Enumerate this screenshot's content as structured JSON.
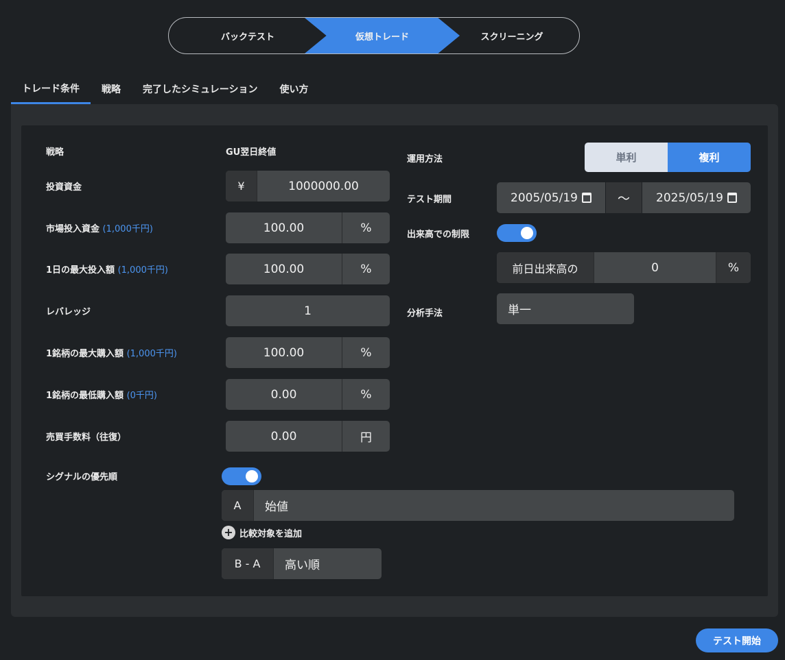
{
  "mode_switch": {
    "items": [
      "バックテスト",
      "仮想トレード",
      "スクリーニング"
    ],
    "active": "仮想トレード"
  },
  "tabs": [
    "トレード条件",
    "戦略",
    "完了したシミュレーション",
    "使い方"
  ],
  "left": {
    "strategy_label": "戦略",
    "strategy_value": "GU翌日終値",
    "capital_label": "投資資金",
    "capital_prefix": "¥",
    "capital_value": "1000000.00",
    "market_label": "市場投入資金",
    "market_hint": "(1,000千円)",
    "market_value": "100.00",
    "market_unit": "%",
    "daily_label": "1日の最大投入額",
    "daily_hint": "(1,000千円)",
    "daily_value": "100.00",
    "daily_unit": "%",
    "leverage_label": "レバレッジ",
    "leverage_value": "1",
    "max_buy_label": "1銘柄の最大購入額",
    "max_buy_hint": "(1,000千円)",
    "max_buy_value": "100.00",
    "max_buy_unit": "%",
    "min_buy_label": "1銘柄の最低購入額",
    "min_buy_hint": "(0千円)",
    "min_buy_value": "0.00",
    "min_buy_unit": "%",
    "fee_label": "売買手数料（往復）",
    "fee_value": "0.00",
    "fee_unit": "円",
    "signal_label": "シグナルの優先順",
    "signal_enabled": true,
    "signal_a_key": "A",
    "signal_a_value": "始値",
    "add_compare": "比較対象を追加",
    "sort_key": "B - A",
    "sort_value": "高い順"
  },
  "right": {
    "method_label": "運用方法",
    "method_options": [
      "単利",
      "複利"
    ],
    "method_selected": "複利",
    "period_label": "テスト期間",
    "period_start": "2005/05/19",
    "period_sep": "〜",
    "period_end": "2025/05/19",
    "volume_label": "出来高での制限",
    "volume_enabled": true,
    "volume_prefix": "前日出来高の",
    "volume_value": "0",
    "volume_unit": "%",
    "analysis_label": "分析手法",
    "analysis_value": "単一"
  },
  "start_button": "テスト開始",
  "colors": {
    "accent": "#3d86e6",
    "background": "#1e2124",
    "panel": "#2b2e31",
    "field": "#444749",
    "hint": "#4c95f0"
  },
  "icons": [
    "calendar-icon",
    "plus-icon",
    "toggle-switch"
  ]
}
